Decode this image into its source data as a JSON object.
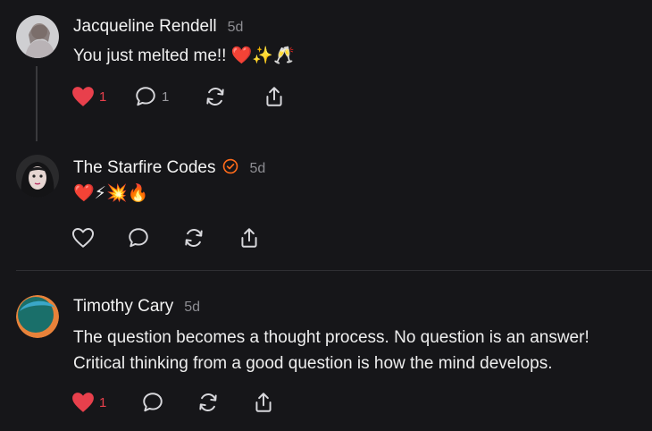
{
  "comments": [
    {
      "author": "Jacqueline Rendell",
      "time": "5d",
      "text": "You just melted me!! ❤️✨🥂",
      "likes": "1",
      "replies": "1",
      "liked": true,
      "verified": false
    },
    {
      "author": "The Starfire Codes",
      "time": "5d",
      "text": "❤️⚡💥🔥",
      "likes": "",
      "replies": "",
      "liked": false,
      "verified": true
    },
    {
      "author": "Timothy Cary",
      "time": "5d",
      "text_line1": "The question becomes a thought process. No question is an answer!",
      "text_line2": "Critical thinking from a good question is how the mind develops.",
      "likes": "1",
      "replies": "",
      "liked": true,
      "verified": false
    }
  ],
  "colors": {
    "background": "#161619",
    "like_red": "#e8404c",
    "verified_orange": "#ff6b1a",
    "muted": "#8d8d92"
  },
  "icons": [
    "heart-icon",
    "comment-icon",
    "repost-icon",
    "share-icon",
    "verified-badge-icon"
  ]
}
